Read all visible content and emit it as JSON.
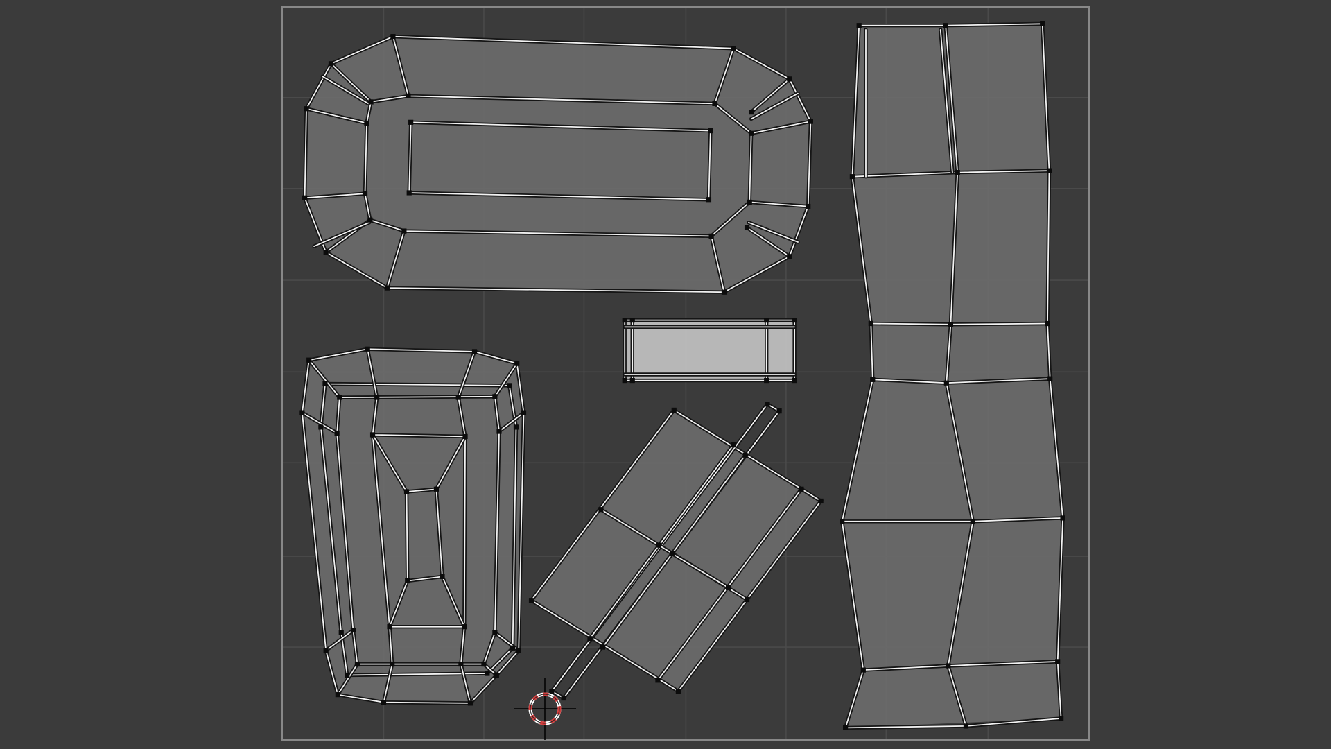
{
  "editor": {
    "background_color": "#3b3b3b",
    "uv_bounds_color": "#888888",
    "grid_color": "#4a4a4a",
    "face_color": "#6b6b6b",
    "selected_face_color": "#c2c2c2",
    "edge_color": "#f2f2f2",
    "vertex_color": "#0c0c0c"
  },
  "uv_islands": [
    "capsule-panel",
    "small-selected-strip",
    "tapered-box",
    "diagonal-cross-strip",
    "tall-vertical-strip"
  ],
  "cursor": {
    "icon": "2d-cursor-icon",
    "color": "#d23c3c"
  }
}
